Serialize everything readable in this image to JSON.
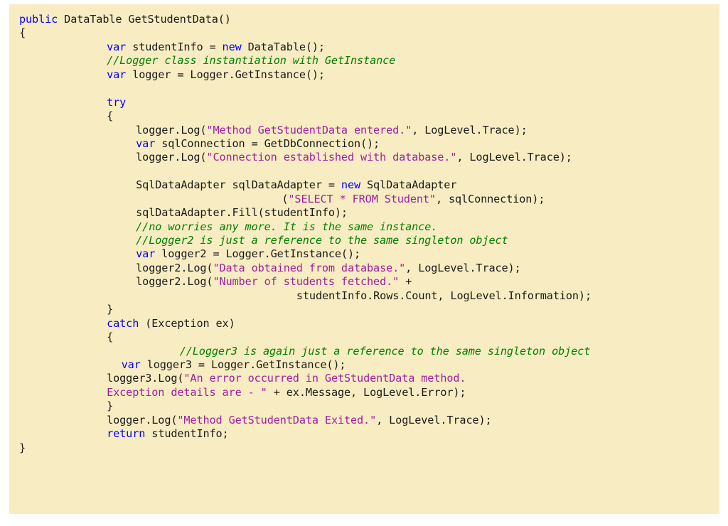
{
  "code_block": {
    "language": "csharp",
    "background_color": "#f8ecc2",
    "page_background_color": "#ffffff",
    "colors": {
      "keyword": "#0000ff",
      "string": "#a020a0",
      "comment": "#008000",
      "plain": "#1a1a1a"
    },
    "lines": [
      {
        "indent": 0,
        "tokens": [
          {
            "t": "kw",
            "s": "public"
          },
          {
            "t": "pl",
            "s": " DataTable GetStudentData()"
          }
        ]
      },
      {
        "indent": 0,
        "tokens": [
          {
            "t": "pl",
            "s": "{"
          }
        ]
      },
      {
        "indent": 12,
        "tokens": [
          {
            "t": "kw",
            "s": "var"
          },
          {
            "t": "pl",
            "s": " studentInfo = "
          },
          {
            "t": "kw",
            "s": "new"
          },
          {
            "t": "pl",
            "s": " DataTable();"
          }
        ]
      },
      {
        "indent": 12,
        "tokens": [
          {
            "t": "cmt",
            "s": "//Logger class instantiation with GetInstance"
          }
        ]
      },
      {
        "indent": 12,
        "tokens": [
          {
            "t": "kw",
            "s": "var"
          },
          {
            "t": "pl",
            "s": " logger = Logger.GetInstance();"
          }
        ]
      },
      {
        "indent": 0,
        "tokens": [
          {
            "t": "pl",
            "s": ""
          }
        ]
      },
      {
        "indent": 12,
        "tokens": [
          {
            "t": "kw",
            "s": "try"
          }
        ]
      },
      {
        "indent": 12,
        "tokens": [
          {
            "t": "pl",
            "s": "{"
          }
        ]
      },
      {
        "indent": 16,
        "tokens": [
          {
            "t": "pl",
            "s": "logger.Log("
          },
          {
            "t": "str",
            "s": "\"Method GetStudentData entered.\""
          },
          {
            "t": "pl",
            "s": ", LogLevel.Trace);"
          }
        ]
      },
      {
        "indent": 16,
        "tokens": [
          {
            "t": "kw",
            "s": "var"
          },
          {
            "t": "pl",
            "s": " sqlConnection = GetDbConnection();"
          }
        ]
      },
      {
        "indent": 16,
        "tokens": [
          {
            "t": "pl",
            "s": "logger.Log("
          },
          {
            "t": "str",
            "s": "\"Connection established with database.\""
          },
          {
            "t": "pl",
            "s": ", LogLevel.Trace);"
          }
        ]
      },
      {
        "indent": 0,
        "tokens": [
          {
            "t": "pl",
            "s": ""
          }
        ]
      },
      {
        "indent": 16,
        "tokens": [
          {
            "t": "pl",
            "s": "SqlDataAdapter sqlDataAdapter = "
          },
          {
            "t": "kw",
            "s": "new"
          },
          {
            "t": "pl",
            "s": " SqlDataAdapter"
          }
        ]
      },
      {
        "indent": 36,
        "tokens": [
          {
            "t": "pl",
            "s": "("
          },
          {
            "t": "str",
            "s": "\"SELECT * FROM Student\""
          },
          {
            "t": "pl",
            "s": ", sqlConnection);"
          }
        ]
      },
      {
        "indent": 16,
        "tokens": [
          {
            "t": "pl",
            "s": "sqlDataAdapter.Fill(studentInfo);"
          }
        ]
      },
      {
        "indent": 16,
        "tokens": [
          {
            "t": "cmt",
            "s": "//no worries any more. It is the same instance."
          }
        ]
      },
      {
        "indent": 16,
        "tokens": [
          {
            "t": "cmt",
            "s": "//Logger2 is just a reference to the same singleton object"
          }
        ]
      },
      {
        "indent": 16,
        "tokens": [
          {
            "t": "kw",
            "s": "var"
          },
          {
            "t": "pl",
            "s": " logger2 = Logger.GetInstance();"
          }
        ]
      },
      {
        "indent": 16,
        "tokens": [
          {
            "t": "pl",
            "s": "logger2.Log("
          },
          {
            "t": "str",
            "s": "\"Data obtained from database.\""
          },
          {
            "t": "pl",
            "s": ", LogLevel.Trace);"
          }
        ]
      },
      {
        "indent": 16,
        "tokens": [
          {
            "t": "pl",
            "s": "logger2.Log("
          },
          {
            "t": "str",
            "s": "\"Number of students fetched.\""
          },
          {
            "t": "pl",
            "s": " +"
          }
        ]
      },
      {
        "indent": 38,
        "tokens": [
          {
            "t": "pl",
            "s": "studentInfo.Rows.Count, LogLevel.Information);"
          }
        ]
      },
      {
        "indent": 12,
        "tokens": [
          {
            "t": "pl",
            "s": "}"
          }
        ]
      },
      {
        "indent": 12,
        "tokens": [
          {
            "t": "kw",
            "s": "catch"
          },
          {
            "t": "pl",
            "s": " (Exception ex)"
          }
        ]
      },
      {
        "indent": 12,
        "tokens": [
          {
            "t": "pl",
            "s": "{"
          }
        ]
      },
      {
        "indent": 22,
        "tokens": [
          {
            "t": "cmt",
            "s": "//Logger3 is again just a reference to the same singleton object"
          }
        ]
      },
      {
        "indent": 14,
        "tokens": [
          {
            "t": "kw",
            "s": "var"
          },
          {
            "t": "pl",
            "s": " logger3 = Logger.GetInstance();"
          }
        ]
      },
      {
        "indent": 12,
        "tokens": [
          {
            "t": "pl",
            "s": "logger3.Log("
          },
          {
            "t": "str",
            "s": "\"An error occurred in GetStudentData method."
          }
        ]
      },
      {
        "indent": 12,
        "tokens": [
          {
            "t": "str",
            "s": "Exception details are - \""
          },
          {
            "t": "pl",
            "s": " + ex.Message, LogLevel.Error);"
          }
        ]
      },
      {
        "indent": 12,
        "tokens": [
          {
            "t": "pl",
            "s": "}"
          }
        ]
      },
      {
        "indent": 12,
        "tokens": [
          {
            "t": "pl",
            "s": "logger.Log("
          },
          {
            "t": "str",
            "s": "\"Method GetStudentData Exited.\""
          },
          {
            "t": "pl",
            "s": ", LogLevel.Trace);"
          }
        ]
      },
      {
        "indent": 12,
        "tokens": [
          {
            "t": "kw",
            "s": "return"
          },
          {
            "t": "pl",
            "s": " studentInfo;"
          }
        ]
      },
      {
        "indent": 0,
        "tokens": [
          {
            "t": "pl",
            "s": "}"
          }
        ]
      }
    ]
  }
}
